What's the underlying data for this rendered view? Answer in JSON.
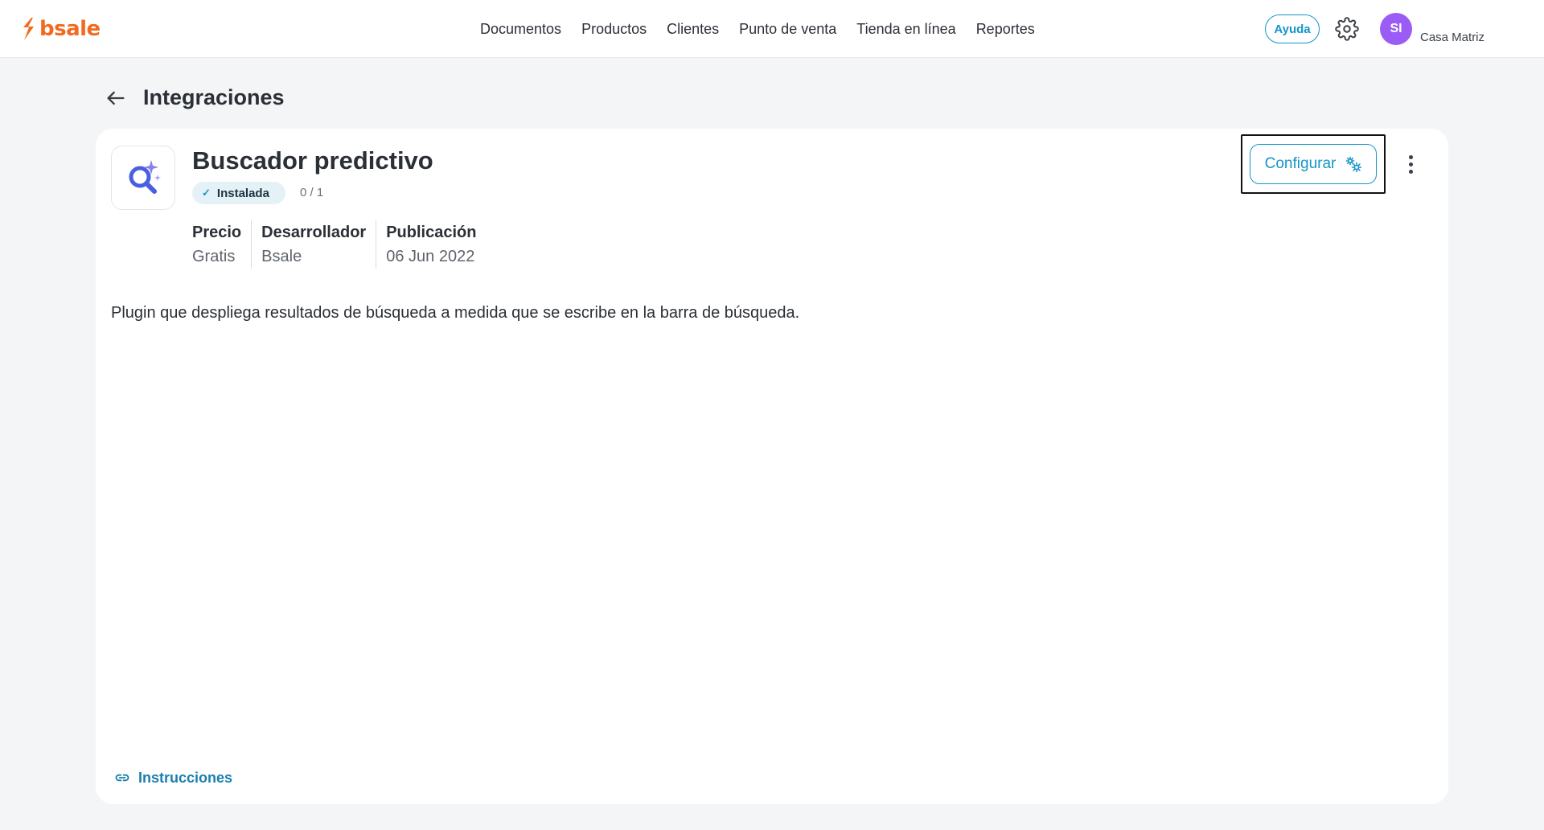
{
  "brand": {
    "name": "bsale",
    "color": "#f26a21"
  },
  "nav": {
    "items": [
      {
        "label": "Documentos"
      },
      {
        "label": "Productos"
      },
      {
        "label": "Clientes"
      },
      {
        "label": "Punto de venta"
      },
      {
        "label": "Tienda en línea"
      },
      {
        "label": "Reportes"
      }
    ]
  },
  "header": {
    "help_label": "Ayuda",
    "settings_icon": "gear-icon",
    "avatar_initials": "SI",
    "avatar_color": "#9b5cf6",
    "branch": "Casa Matriz"
  },
  "page": {
    "title": "Integraciones",
    "back_icon": "arrow-left-icon"
  },
  "app": {
    "icon": "search-sparkle-icon",
    "name": "Buscador predictivo",
    "status": "Instalada",
    "install_count": "0 / 1",
    "meta": [
      {
        "label": "Precio",
        "value": "Gratis"
      },
      {
        "label": "Desarrollador",
        "value": "Bsale"
      },
      {
        "label": "Publicación",
        "value": "06 Jun 2022"
      }
    ],
    "description": "Plugin que despliega resultados de búsqueda a medida que se escribe en la barra de búsqueda.",
    "configure_label": "Configurar",
    "instructions_label": "Instrucciones"
  },
  "colors": {
    "accent": "#1495c9",
    "background": "#f4f5f7"
  }
}
